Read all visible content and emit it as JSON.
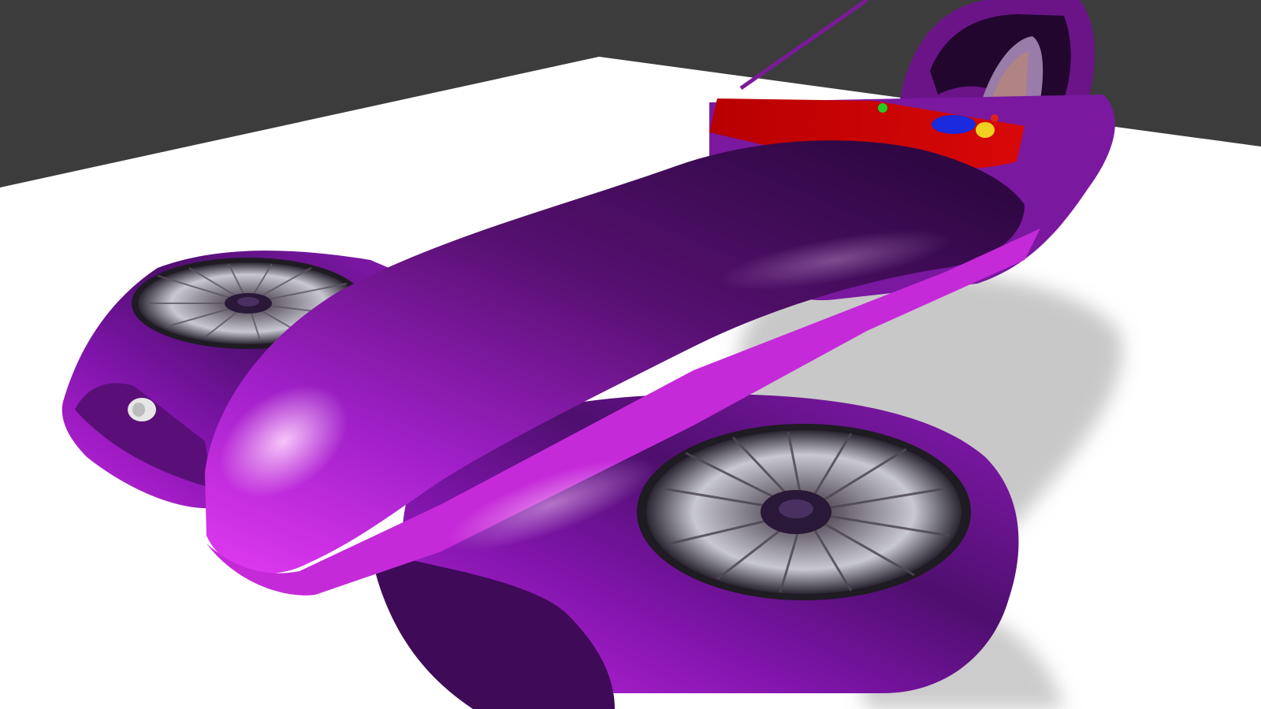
{
  "scene": {
    "subject": "hover-vehicle-render",
    "colors": {
      "backdrop": "#3c3c3c",
      "floor": "#ffffff",
      "shadow": "#8f8f8f",
      "body_dark": "#3a0a4e",
      "body_mid": "#8a1ab5",
      "body_light": "#e23af2",
      "highlight": "#ffd6ff",
      "cockpit_red": "#c40000",
      "fan_metal": "#b8b8c4",
      "fan_dark": "#1e1b22"
    },
    "icons": [
      "front-left-fan-icon",
      "rear-right-fan-icon",
      "seat-icon",
      "controls-icon"
    ]
  }
}
